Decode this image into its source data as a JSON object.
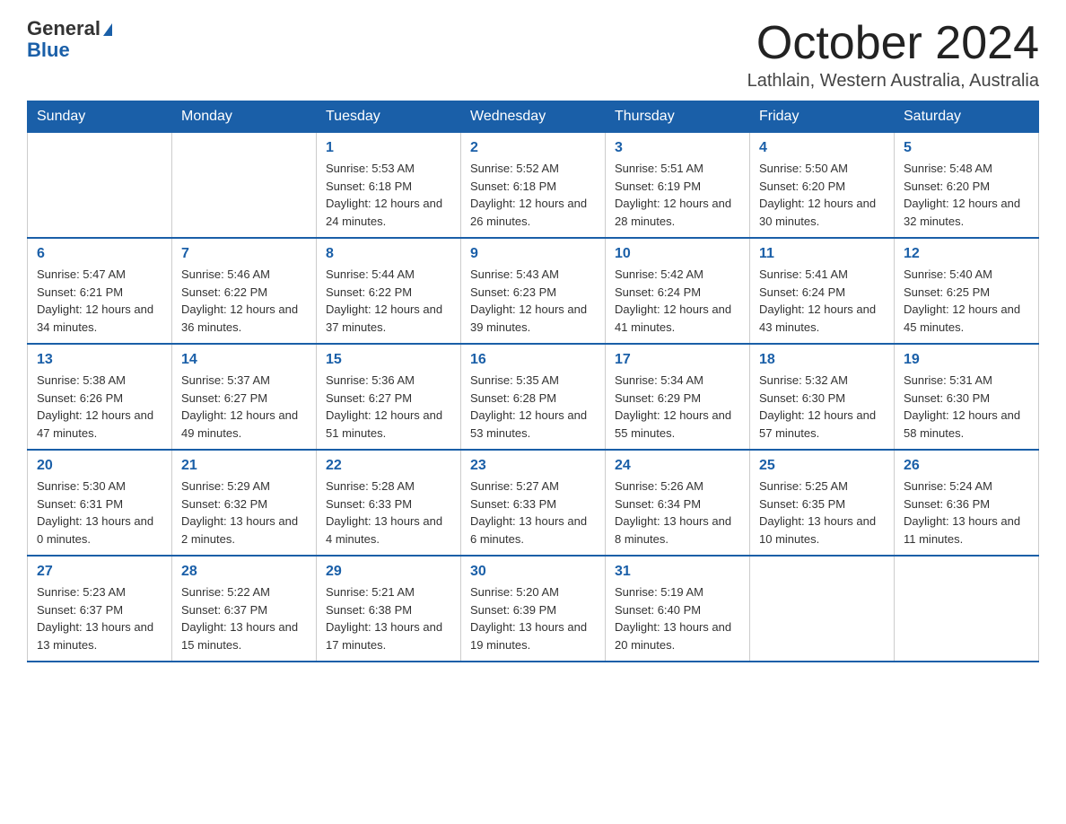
{
  "header": {
    "logo_general": "General",
    "logo_blue": "Blue",
    "month_title": "October 2024",
    "location": "Lathlain, Western Australia, Australia"
  },
  "days_of_week": [
    "Sunday",
    "Monday",
    "Tuesday",
    "Wednesday",
    "Thursday",
    "Friday",
    "Saturday"
  ],
  "weeks": [
    [
      {
        "day": "",
        "sunrise": "",
        "sunset": "",
        "daylight": ""
      },
      {
        "day": "",
        "sunrise": "",
        "sunset": "",
        "daylight": ""
      },
      {
        "day": "1",
        "sunrise": "Sunrise: 5:53 AM",
        "sunset": "Sunset: 6:18 PM",
        "daylight": "Daylight: 12 hours and 24 minutes."
      },
      {
        "day": "2",
        "sunrise": "Sunrise: 5:52 AM",
        "sunset": "Sunset: 6:18 PM",
        "daylight": "Daylight: 12 hours and 26 minutes."
      },
      {
        "day": "3",
        "sunrise": "Sunrise: 5:51 AM",
        "sunset": "Sunset: 6:19 PM",
        "daylight": "Daylight: 12 hours and 28 minutes."
      },
      {
        "day": "4",
        "sunrise": "Sunrise: 5:50 AM",
        "sunset": "Sunset: 6:20 PM",
        "daylight": "Daylight: 12 hours and 30 minutes."
      },
      {
        "day": "5",
        "sunrise": "Sunrise: 5:48 AM",
        "sunset": "Sunset: 6:20 PM",
        "daylight": "Daylight: 12 hours and 32 minutes."
      }
    ],
    [
      {
        "day": "6",
        "sunrise": "Sunrise: 5:47 AM",
        "sunset": "Sunset: 6:21 PM",
        "daylight": "Daylight: 12 hours and 34 minutes."
      },
      {
        "day": "7",
        "sunrise": "Sunrise: 5:46 AM",
        "sunset": "Sunset: 6:22 PM",
        "daylight": "Daylight: 12 hours and 36 minutes."
      },
      {
        "day": "8",
        "sunrise": "Sunrise: 5:44 AM",
        "sunset": "Sunset: 6:22 PM",
        "daylight": "Daylight: 12 hours and 37 minutes."
      },
      {
        "day": "9",
        "sunrise": "Sunrise: 5:43 AM",
        "sunset": "Sunset: 6:23 PM",
        "daylight": "Daylight: 12 hours and 39 minutes."
      },
      {
        "day": "10",
        "sunrise": "Sunrise: 5:42 AM",
        "sunset": "Sunset: 6:24 PM",
        "daylight": "Daylight: 12 hours and 41 minutes."
      },
      {
        "day": "11",
        "sunrise": "Sunrise: 5:41 AM",
        "sunset": "Sunset: 6:24 PM",
        "daylight": "Daylight: 12 hours and 43 minutes."
      },
      {
        "day": "12",
        "sunrise": "Sunrise: 5:40 AM",
        "sunset": "Sunset: 6:25 PM",
        "daylight": "Daylight: 12 hours and 45 minutes."
      }
    ],
    [
      {
        "day": "13",
        "sunrise": "Sunrise: 5:38 AM",
        "sunset": "Sunset: 6:26 PM",
        "daylight": "Daylight: 12 hours and 47 minutes."
      },
      {
        "day": "14",
        "sunrise": "Sunrise: 5:37 AM",
        "sunset": "Sunset: 6:27 PM",
        "daylight": "Daylight: 12 hours and 49 minutes."
      },
      {
        "day": "15",
        "sunrise": "Sunrise: 5:36 AM",
        "sunset": "Sunset: 6:27 PM",
        "daylight": "Daylight: 12 hours and 51 minutes."
      },
      {
        "day": "16",
        "sunrise": "Sunrise: 5:35 AM",
        "sunset": "Sunset: 6:28 PM",
        "daylight": "Daylight: 12 hours and 53 minutes."
      },
      {
        "day": "17",
        "sunrise": "Sunrise: 5:34 AM",
        "sunset": "Sunset: 6:29 PM",
        "daylight": "Daylight: 12 hours and 55 minutes."
      },
      {
        "day": "18",
        "sunrise": "Sunrise: 5:32 AM",
        "sunset": "Sunset: 6:30 PM",
        "daylight": "Daylight: 12 hours and 57 minutes."
      },
      {
        "day": "19",
        "sunrise": "Sunrise: 5:31 AM",
        "sunset": "Sunset: 6:30 PM",
        "daylight": "Daylight: 12 hours and 58 minutes."
      }
    ],
    [
      {
        "day": "20",
        "sunrise": "Sunrise: 5:30 AM",
        "sunset": "Sunset: 6:31 PM",
        "daylight": "Daylight: 13 hours and 0 minutes."
      },
      {
        "day": "21",
        "sunrise": "Sunrise: 5:29 AM",
        "sunset": "Sunset: 6:32 PM",
        "daylight": "Daylight: 13 hours and 2 minutes."
      },
      {
        "day": "22",
        "sunrise": "Sunrise: 5:28 AM",
        "sunset": "Sunset: 6:33 PM",
        "daylight": "Daylight: 13 hours and 4 minutes."
      },
      {
        "day": "23",
        "sunrise": "Sunrise: 5:27 AM",
        "sunset": "Sunset: 6:33 PM",
        "daylight": "Daylight: 13 hours and 6 minutes."
      },
      {
        "day": "24",
        "sunrise": "Sunrise: 5:26 AM",
        "sunset": "Sunset: 6:34 PM",
        "daylight": "Daylight: 13 hours and 8 minutes."
      },
      {
        "day": "25",
        "sunrise": "Sunrise: 5:25 AM",
        "sunset": "Sunset: 6:35 PM",
        "daylight": "Daylight: 13 hours and 10 minutes."
      },
      {
        "day": "26",
        "sunrise": "Sunrise: 5:24 AM",
        "sunset": "Sunset: 6:36 PM",
        "daylight": "Daylight: 13 hours and 11 minutes."
      }
    ],
    [
      {
        "day": "27",
        "sunrise": "Sunrise: 5:23 AM",
        "sunset": "Sunset: 6:37 PM",
        "daylight": "Daylight: 13 hours and 13 minutes."
      },
      {
        "day": "28",
        "sunrise": "Sunrise: 5:22 AM",
        "sunset": "Sunset: 6:37 PM",
        "daylight": "Daylight: 13 hours and 15 minutes."
      },
      {
        "day": "29",
        "sunrise": "Sunrise: 5:21 AM",
        "sunset": "Sunset: 6:38 PM",
        "daylight": "Daylight: 13 hours and 17 minutes."
      },
      {
        "day": "30",
        "sunrise": "Sunrise: 5:20 AM",
        "sunset": "Sunset: 6:39 PM",
        "daylight": "Daylight: 13 hours and 19 minutes."
      },
      {
        "day": "31",
        "sunrise": "Sunrise: 5:19 AM",
        "sunset": "Sunset: 6:40 PM",
        "daylight": "Daylight: 13 hours and 20 minutes."
      },
      {
        "day": "",
        "sunrise": "",
        "sunset": "",
        "daylight": ""
      },
      {
        "day": "",
        "sunrise": "",
        "sunset": "",
        "daylight": ""
      }
    ]
  ]
}
